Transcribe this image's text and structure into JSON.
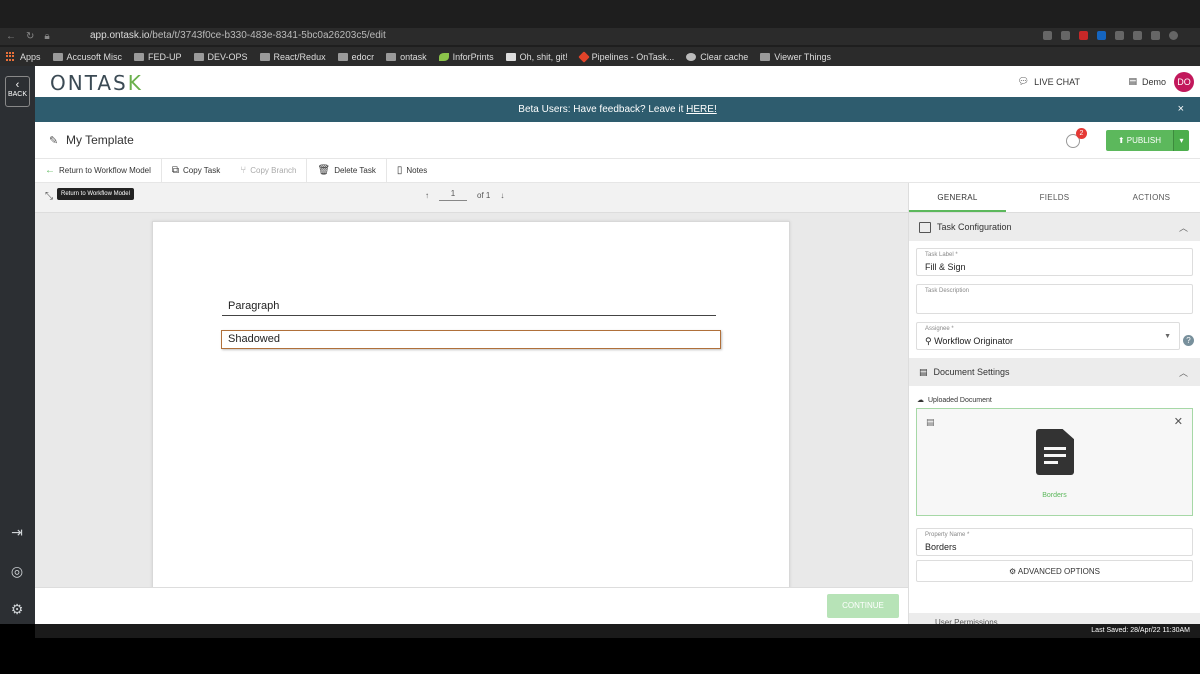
{
  "browser": {
    "url_host": "app.ontask.io",
    "url_path": "/beta/t/3743f0ce-b330-483e-8341-5bc0a26203c5/edit",
    "bookmarks": [
      "Apps",
      "Accusoft Misc",
      "FED-UP",
      "DEV-OPS",
      "React/Redux",
      "edocr",
      "ontask",
      "InforPrints",
      "Oh, shit, git!",
      "Pipelines - OnTask...",
      "Clear cache",
      "Viewer Things"
    ]
  },
  "sidebar": {
    "back_label": "BACK"
  },
  "header": {
    "logo_main": "ONTAS",
    "logo_accent": "K",
    "live_chat": "LIVE CHAT",
    "demo": "Demo",
    "avatar_initials": "DO"
  },
  "banner": {
    "text": "Beta Users: Have feedback? Leave it ",
    "link": "HERE!",
    "close": "×"
  },
  "titlebar": {
    "title": "My Template",
    "notification_count": "2",
    "publish_label": "PUBLISH"
  },
  "toolbar": {
    "return_label": "Return to Workflow Model",
    "copy_task": "Copy Task",
    "copy_branch": "Copy Branch",
    "delete_task": "Delete Task",
    "notes": "Notes"
  },
  "viewer": {
    "tooltip": "Return to Workflow Model",
    "page_current": "1",
    "page_total": "of 1",
    "fields": {
      "paragraph": "Paragraph",
      "shadowed": "Shadowed"
    },
    "continue_label": "CONTINUE"
  },
  "panel": {
    "tabs": [
      "GENERAL",
      "FIELDS",
      "ACTIONS"
    ],
    "task_config_title": "Task Configuration",
    "task_label_lbl": "Task Label *",
    "task_label_val": "Fill & Sign",
    "task_desc_lbl": "Task Description",
    "assignee_lbl": "Assignee *",
    "assignee_val": "Workflow Originator",
    "doc_settings_title": "Document Settings",
    "uploaded_lbl": "Uploaded Document",
    "uploaded_name": "Borders",
    "property_lbl": "Property Name *",
    "property_val": "Borders",
    "advanced_label": "ADVANCED OPTIONS",
    "user_permissions": "User Permissions"
  },
  "status": {
    "last_saved": "Last Saved: 28/Apr/22 11:30AM"
  },
  "colors": {
    "accent_green": "#5cb85c",
    "banner_teal": "#2e5c6e",
    "avatar_pink": "#c2185b"
  }
}
